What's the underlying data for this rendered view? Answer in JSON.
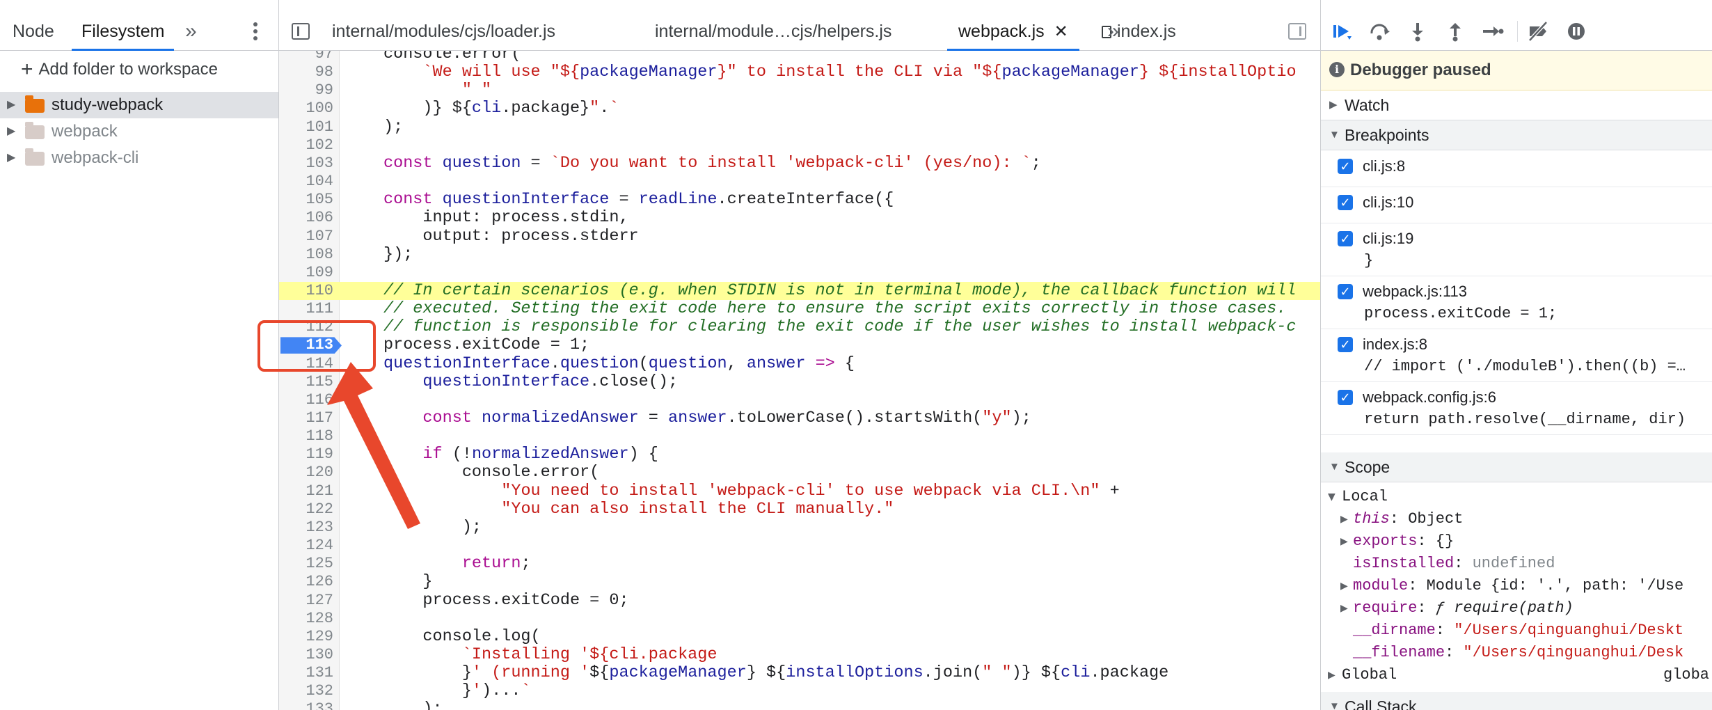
{
  "left_panel": {
    "tabs": [
      "Node",
      "Filesystem"
    ],
    "active_tab": "Filesystem",
    "add_folder_label": "Add folder to workspace",
    "tree": [
      {
        "label": "study-webpack",
        "selected": true,
        "folder_color": "#e8710a"
      },
      {
        "label": "webpack",
        "selected": false,
        "folder_color": "#d7ccc8"
      },
      {
        "label": "webpack-cli",
        "selected": false,
        "folder_color": "#d7ccc8"
      }
    ]
  },
  "editor": {
    "tabs": [
      {
        "label": "internal/modules/cjs/loader.js",
        "active": false
      },
      {
        "label": "internal/module…cjs/helpers.js",
        "active": false
      },
      {
        "label": "webpack.js",
        "active": true,
        "closable": true
      },
      {
        "label": "index.js",
        "active": false,
        "has_file_icon": true
      }
    ],
    "paused_line": 113,
    "highlight_line": 110,
    "lines": [
      {
        "n": "97",
        "text": "console.error("
      },
      {
        "n": "98",
        "text": "    `We will use \"${packageManager}\" to install the CLI via \"${packageManager} ${installOptio"
      },
      {
        "n": "99",
        "text": "        \" \""
      },
      {
        "n": "100",
        "text": "    )} ${cli.package}\".`"
      },
      {
        "n": "101",
        "text": ");"
      },
      {
        "n": "102",
        "text": ""
      },
      {
        "n": "103",
        "text": "const question = `Do you want to install 'webpack-cli' (yes/no): `;"
      },
      {
        "n": "104",
        "text": ""
      },
      {
        "n": "105",
        "text": "const questionInterface = readLine.createInterface({"
      },
      {
        "n": "106",
        "text": "    input: process.stdin,"
      },
      {
        "n": "107",
        "text": "    output: process.stderr"
      },
      {
        "n": "108",
        "text": "});"
      },
      {
        "n": "109",
        "text": ""
      },
      {
        "n": "110",
        "text": "// In certain scenarios (e.g. when STDIN is not in terminal mode), the callback function will"
      },
      {
        "n": "111",
        "text": "// executed. Setting the exit code here to ensure the script exits correctly in those cases."
      },
      {
        "n": "112",
        "text": "// function is responsible for clearing the exit code if the user wishes to install webpack-c"
      },
      {
        "n": "113",
        "text": "process.exitCode = 1;"
      },
      {
        "n": "114",
        "text": "questionInterface.question(question, answer => {"
      },
      {
        "n": "115",
        "text": "    questionInterface.close();"
      },
      {
        "n": "116",
        "text": ""
      },
      {
        "n": "117",
        "text": "    const normalizedAnswer = answer.toLowerCase().startsWith(\"y\");"
      },
      {
        "n": "118",
        "text": ""
      },
      {
        "n": "119",
        "text": "    if (!normalizedAnswer) {"
      },
      {
        "n": "120",
        "text": "        console.error("
      },
      {
        "n": "121",
        "text": "            \"You need to install 'webpack-cli' to use webpack via CLI.\\n\" +"
      },
      {
        "n": "122",
        "text": "            \"You can also install the CLI manually.\""
      },
      {
        "n": "123",
        "text": "        );"
      },
      {
        "n": "124",
        "text": ""
      },
      {
        "n": "125",
        "text": "        return;"
      },
      {
        "n": "126",
        "text": "    }"
      },
      {
        "n": "127",
        "text": "    process.exitCode = 0;"
      },
      {
        "n": "128",
        "text": ""
      },
      {
        "n": "129",
        "text": "    console.log("
      },
      {
        "n": "130",
        "text": "        `Installing '${cli.package"
      },
      {
        "n": "131",
        "text": "        }' (running '${packageManager} ${installOptions.join(\" \")} ${cli.package"
      },
      {
        "n": "132",
        "text": "        }')...`"
      },
      {
        "n": "133",
        "text": "    );"
      }
    ]
  },
  "debugger": {
    "paused_label": "Debugger paused",
    "sections": {
      "watch": "Watch",
      "breakpoints": "Breakpoints",
      "scope": "Scope",
      "call_stack": "Call Stack"
    },
    "breakpoints": [
      {
        "location": "cli.js:8",
        "code": ""
      },
      {
        "location": "cli.js:10",
        "code": ""
      },
      {
        "location": "cli.js:19",
        "code": "}"
      },
      {
        "location": "webpack.js:113",
        "code": "process.exitCode = 1;"
      },
      {
        "location": "index.js:8",
        "code": "// import ('./moduleB').then((b) =…"
      },
      {
        "location": "webpack.config.js:6",
        "code": "return path.resolve(__dirname, dir)"
      }
    ],
    "scope": {
      "local_label": "Local",
      "global_label": "Global",
      "global_value": "globa",
      "vars": [
        {
          "name": "this",
          "value": "Object",
          "expandable": true,
          "italic": true
        },
        {
          "name": "exports",
          "value": "{}",
          "expandable": true
        },
        {
          "name": "isInstalled",
          "value": "undefined",
          "expandable": false
        },
        {
          "name": "module",
          "value": "Module {id: '.', path: '/Use",
          "expandable": true
        },
        {
          "name": "require",
          "value": "ƒ require(path)",
          "expandable": true
        },
        {
          "name": "__dirname",
          "value": "\"/Users/qinguanghui/Deskt",
          "expandable": false
        },
        {
          "name": "__filename",
          "value": "\"/Users/qinguanghui/Desk",
          "expandable": false
        }
      ]
    }
  }
}
